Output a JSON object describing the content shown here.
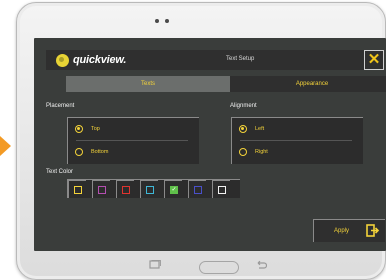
{
  "app": {
    "brand": "quickview.",
    "title": "Text Setup",
    "close_icon": "close-icon"
  },
  "tabs": [
    {
      "label": "Texts",
      "active": true
    },
    {
      "label": "Appearance",
      "active": false
    }
  ],
  "placement": {
    "label": "Placement",
    "options": [
      {
        "label": "Top",
        "selected": true
      },
      {
        "label": "Bottom",
        "selected": false
      }
    ]
  },
  "alignment": {
    "label": "Alignment",
    "options": [
      {
        "label": "Left",
        "selected": true
      },
      {
        "label": "Right",
        "selected": false
      }
    ]
  },
  "text_color": {
    "label": "Text Color",
    "swatches": [
      {
        "color": "#f4d33a",
        "selected": false
      },
      {
        "color": "#b44fb1",
        "selected": false
      },
      {
        "color": "#e0342f",
        "selected": false
      },
      {
        "color": "#3fb7d6",
        "selected": false
      },
      {
        "color": "#5fc04a",
        "selected": true
      },
      {
        "color": "#4a50c9",
        "selected": false
      },
      {
        "color": "#f2f2f2",
        "selected": false
      }
    ]
  },
  "apply": {
    "label": "Apply",
    "icon": "exit-icon"
  },
  "colors": {
    "accent": "#f4d33a",
    "screen_bg": "#3a3d3b",
    "panel_bg": "#2c2c2c",
    "indicator_arrow": "#f39a24"
  }
}
